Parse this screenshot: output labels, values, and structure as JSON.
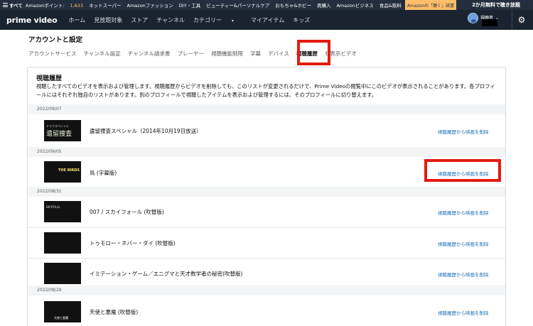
{
  "topbar": {
    "menu_label": "すべて",
    "points_label": "Amazonポイント:",
    "points_value": "1,633",
    "links": [
      "ネットスーパー",
      "Amazonファッション",
      "DIY・工具",
      "ビューティー&パーソナルケア",
      "おもちゃ&ホビー",
      "再購入",
      "Amazonビジネス",
      "食品&飲料"
    ],
    "promo": "Amazonの「聴く」読書",
    "trial": "2か月無料で聴き放題"
  },
  "header": {
    "logo": "prime video",
    "nav": [
      "ホーム",
      "見放題対象",
      "ストア",
      "チャンネル",
      "カテゴリー",
      "マイアイテム",
      "キッズ"
    ],
    "profile_label": "視聴者"
  },
  "page": {
    "title": "アカウントと設定",
    "tabs": [
      "アカウントサービス",
      "チャンネル設定",
      "チャンネル請求書",
      "プレーヤー",
      "視聴機能制限",
      "字幕",
      "デバイス",
      "視聴履歴",
      "非表示ビデオ"
    ],
    "active_tab": "視聴履歴"
  },
  "history": {
    "title": "視聴履歴",
    "description": "視聴したすべてのビデオを表示および管理します。視聴履歴からビデオを削除しても、このリストが変更されるだけで、Prime Videoの閲覧中にこのビデオが表示されることがあります。各プロフィールにはそれぞれ独自のリストがあります。別のプロフィールで視聴したアイテムを表示および管理するには、そのプロフィールに切り替えます。",
    "delete_label": "視聴履歴から映画を削除",
    "groups": [
      {
        "date": "2022/09/07",
        "items": [
          {
            "title": "遺留捜査スペシャル（2014年10月19日放送）",
            "thumb_text": "遺留捜査",
            "thumb_sub": "ドラマスペシャル"
          }
        ]
      },
      {
        "date": "2022/09/05",
        "items": [
          {
            "title": "鳥 (字幕版)"
          }
        ]
      },
      {
        "date": "2022/08/31",
        "items": [
          {
            "title": "007 / スカイフォール (吹替版)"
          },
          {
            "title": "トゥモロー・ネバー・ダイ (吹替版)"
          },
          {
            "title": "イミテーション・ゲーム／エニグマと天才数学者の秘密(吹替版)"
          }
        ]
      },
      {
        "date": "2022/08/29",
        "items": [
          {
            "title": "天使と悪魔 (吹替版)"
          }
        ]
      }
    ]
  }
}
